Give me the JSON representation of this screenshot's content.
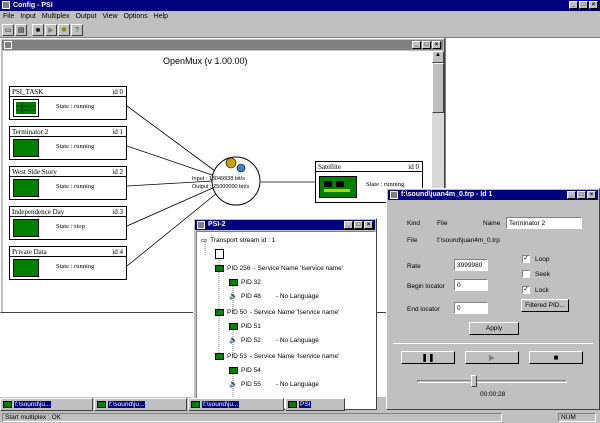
{
  "app": {
    "title": "Config - PSI"
  },
  "menu": [
    "File",
    "Input",
    "Multiplex",
    "Output",
    "View",
    "Options",
    "Help"
  ],
  "toolbar_icons": [
    "new-icon",
    "open-icon",
    "stop-icon",
    "play-icon",
    "settings-icon",
    "help-icon"
  ],
  "openmux": {
    "title": "OpenMux (v 1.00.00)",
    "hub": {
      "input": "Input : 13049938 bit/s",
      "output": "Output : 25000000 bit/s"
    },
    "inputs": [
      {
        "name": "PSI_TASK",
        "id": "id 0",
        "state": "State : running"
      },
      {
        "name": "Terminator 2",
        "id": "id 1",
        "state": "State : running"
      },
      {
        "name": "West Side Story",
        "id": "id 2",
        "state": "State : running"
      },
      {
        "name": "Independence Day",
        "id": "id 3",
        "state": "State : stop"
      },
      {
        "name": "Private Data",
        "id": "id 4",
        "state": "State : running"
      }
    ],
    "output": {
      "name": "Satellite",
      "id": "id 0",
      "state": "State : running"
    }
  },
  "psi": {
    "title": "PSI-2",
    "root": "Transport stream id : 1",
    "items": [
      {
        "pid": "PID 256",
        "service": "- Service Name 'Iservice name'",
        "children": [
          {
            "pid": "PID 32",
            "lang": ""
          },
          {
            "pid": "PID 48",
            "lang": "- No Language"
          }
        ]
      },
      {
        "pid": "PID 50",
        "service": "- Service Name 'Iservice name'",
        "children": [
          {
            "pid": "PID 51",
            "lang": ""
          },
          {
            "pid": "PID 52",
            "lang": "- No Language"
          }
        ]
      },
      {
        "pid": "PID 53",
        "service": "- Service Name 'Iservice name'",
        "children": [
          {
            "pid": "PID 54",
            "lang": ""
          },
          {
            "pid": "PID 55",
            "lang": "- No Language"
          }
        ]
      }
    ]
  },
  "file_window": {
    "title": "f:\\sound\\juan4m_0.trp - Id 1",
    "kind_label": "Kind",
    "kind_value": "File",
    "name_label": "Name",
    "name_value": "Terminator 2",
    "file_label": "File",
    "file_value": "f:\\sound\\juan4m_0.trp",
    "rate_label": "Rate",
    "rate_value": "3999980",
    "begin_label": "Begin locator",
    "begin_value": "0",
    "end_label": "End locator",
    "end_value": "0",
    "loop_label": "Loop",
    "loop_checked": true,
    "seek_label": "Seek",
    "seek_checked": false,
    "lock_label": "Lock",
    "lock_checked": true,
    "filtered_label": "Filtered PID...",
    "apply_label": "Apply",
    "time": "00:00:28",
    "slider_position": 0.38
  },
  "taskbar": [
    {
      "label": "f:\\sound\\ju..."
    },
    {
      "label": "f:\\sound\\ju..."
    },
    {
      "label": "f:\\sound\\ju..."
    },
    {
      "label": "f:\\sound\\ju..."
    },
    {
      "label": "PSI"
    }
  ],
  "status": {
    "left": "Start multiplex : OK",
    "right": "NUM"
  }
}
